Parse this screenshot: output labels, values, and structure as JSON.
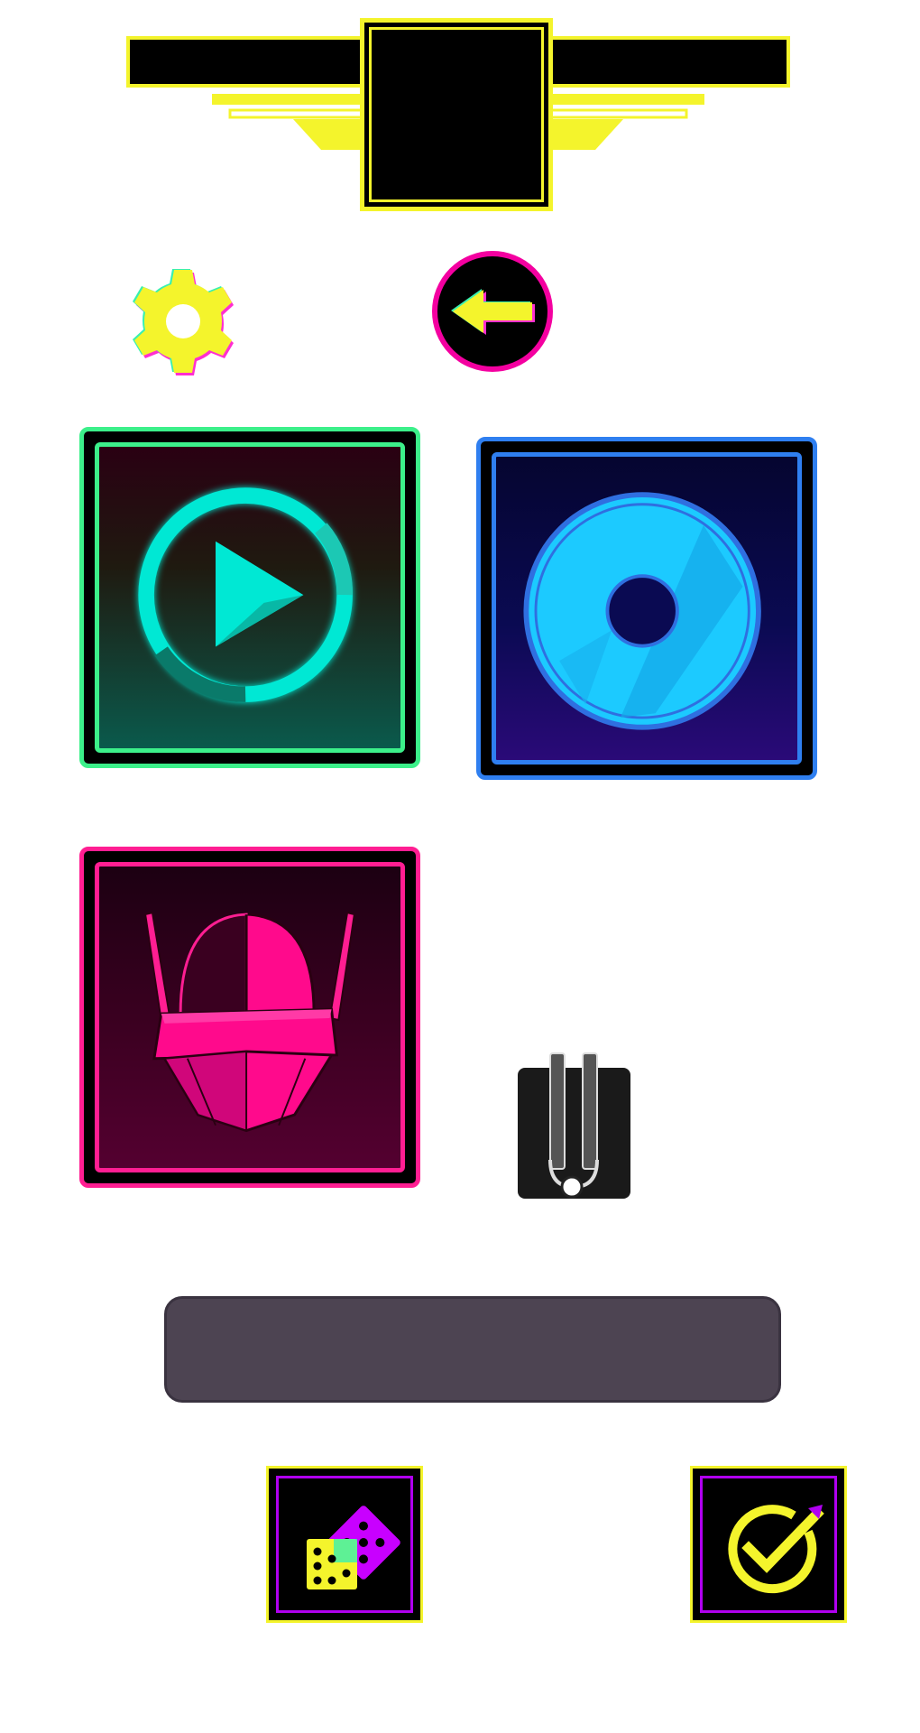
{
  "screen": {
    "name_input": {
      "value": "",
      "placeholder": ""
    }
  },
  "icons": {
    "banner": "title-banner",
    "settings": "gear-icon",
    "back": "arrow-left-icon",
    "play": "play-icon",
    "music": "disc-icon",
    "character": "robot-helmet-icon",
    "tuning": "tuning-fork-icon",
    "random": "dice-icon",
    "confirm": "checkmark-icon"
  },
  "colors": {
    "accent_yellow": "#f4f42c",
    "accent_magenta": "#f400a0",
    "accent_green": "#3cf08a",
    "accent_cyan": "#00e8d4",
    "accent_blue": "#2f7ff0",
    "accent_pink": "#ff1e92",
    "accent_purple": "#b000f0",
    "input_bg": "#4d4452"
  }
}
